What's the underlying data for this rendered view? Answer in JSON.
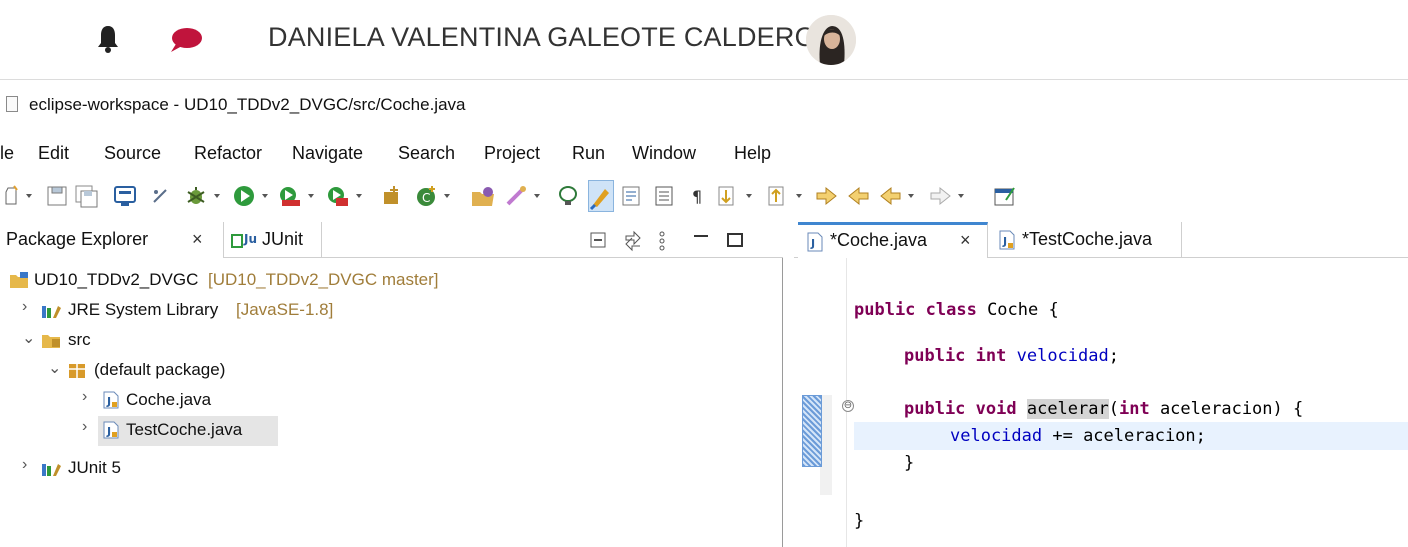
{
  "user": {
    "name": "DANIELA VALENTINA GALEOTE CALDERON"
  },
  "window": {
    "title": "eclipse-workspace - UD10_TDDv2_DVGC/src/Coche.java"
  },
  "menu": {
    "items": [
      "le",
      "Edit",
      "Source",
      "Refactor",
      "Navigate",
      "Search",
      "Project",
      "Run",
      "Window",
      "Help"
    ]
  },
  "left_panel": {
    "tabs": [
      {
        "label": "Package Explorer",
        "close": "×"
      },
      {
        "label": "JUnit"
      }
    ],
    "tree": [
      {
        "label": "UD10_TDDv2_DVGC",
        "decoration": "[UD10_TDDv2_DVGC master]"
      },
      {
        "label": "JRE System Library",
        "decoration": "[JavaSE-1.8]"
      },
      {
        "label": "src"
      },
      {
        "label": "(default package)"
      },
      {
        "label": "Coche.java"
      },
      {
        "label": "TestCoche.java"
      },
      {
        "label": "JUnit 5"
      }
    ],
    "twisty_collapsed": "›",
    "twisty_expanded": "⌄"
  },
  "editor": {
    "tabs": [
      {
        "label": "*Coche.java",
        "close": "×",
        "active": true
      },
      {
        "label": "*TestCoche.java",
        "active": false
      }
    ],
    "code": {
      "l1_kw": "public class",
      "l1_rest": " Coche {",
      "l2_kw": "public int",
      "l2_field": "velocidad",
      "l2_end": ";",
      "l3_kw": "public void",
      "l3_method": "acelerar",
      "l3_open": "(",
      "l3_kw2": "int",
      "l3_param": " aceleracion) {",
      "l4_field": "velocidad",
      "l4_rest": " += aceleracion;",
      "l5": "}",
      "l6": "}"
    },
    "fold_symbol": "⊖"
  },
  "colors": {
    "keyword": "#7f0055",
    "field": "#0000c0",
    "chat_icon": "#c0143c",
    "current_line": "#e8f2fe"
  }
}
